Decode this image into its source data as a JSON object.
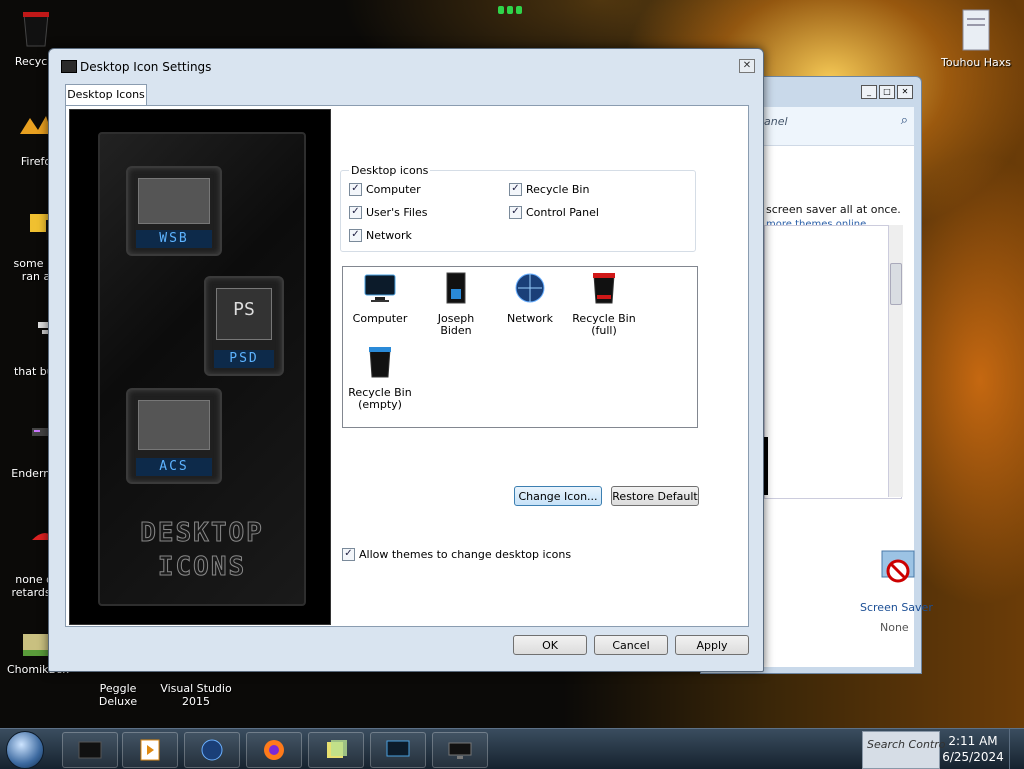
{
  "desktop": {
    "icons": [
      {
        "label": "Recycle",
        "icon": "recycle-bin-icon"
      },
      {
        "label": "Firefo",
        "icon": "firefox-icon"
      },
      {
        "label": "some ru\nran a",
        "icon": "folder-icon"
      },
      {
        "label": "that but",
        "icon": "shortcut-icon"
      },
      {
        "label": "Enderma",
        "icon": "enderman-icon"
      },
      {
        "label": "none of\nretards k",
        "icon": "red-icon"
      },
      {
        "label": "ChomikBox",
        "icon": "chomikbox-icon"
      },
      {
        "label": "Peggle Deluxe",
        "icon": "peggle-icon"
      },
      {
        "label": "Visual Studio\n2015",
        "icon": "visual-studio-icon"
      },
      {
        "label": "Touhou Haxs",
        "icon": "text-file-icon"
      }
    ]
  },
  "background_window": {
    "search_placeholder": "anel",
    "description": "screen saver all at once.",
    "link": "more themes online",
    "screen_saver_label": "Screen Saver",
    "screen_saver_value": "None"
  },
  "dialog": {
    "title": "Desktop Icon Settings",
    "close_glyph": "✕",
    "tab_label": "Desktop Icons",
    "banner": {
      "tiles": [
        "WSB",
        "PS",
        "PSD",
        "ACS"
      ],
      "title_line1": "DESKTOP",
      "title_line2": "ICONS"
    },
    "group_label": "Desktop icons",
    "checkboxes": [
      {
        "label": "Computer",
        "checked": true
      },
      {
        "label": "Recycle Bin",
        "checked": true
      },
      {
        "label": "User's Files",
        "checked": true
      },
      {
        "label": "Control Panel",
        "checked": true
      },
      {
        "label": "Network",
        "checked": true
      }
    ],
    "icon_list": [
      {
        "label": "Computer",
        "icon": "monitor-icon"
      },
      {
        "label": "Joseph Biden",
        "icon": "user-folder-icon"
      },
      {
        "label": "Network",
        "icon": "globe-icon"
      },
      {
        "label": "Recycle Bin\n(full)",
        "icon": "recycle-bin-full-icon"
      },
      {
        "label": "Recycle Bin\n(empty)",
        "icon": "recycle-bin-empty-icon"
      }
    ],
    "change_icon_label": "Change Icon...",
    "restore_default_label": "Restore Default",
    "allow_themes_label": "Allow themes to change desktop icons",
    "allow_themes_checked": true,
    "ok_label": "OK",
    "cancel_label": "Cancel",
    "apply_label": "Apply"
  },
  "taskbar": {
    "search_text": "Search Contro",
    "time": "2:11 AM",
    "date": "6/25/2024",
    "items": [
      "desktop-icon",
      "media-player-icon",
      "globe-icon",
      "firefox-icon",
      "notes-icon",
      "monitor-icon",
      "display-icon"
    ]
  },
  "colors": {
    "accent": "#3c7fb1",
    "link": "#2a5fa8",
    "tile_text": "#5db3ff"
  }
}
